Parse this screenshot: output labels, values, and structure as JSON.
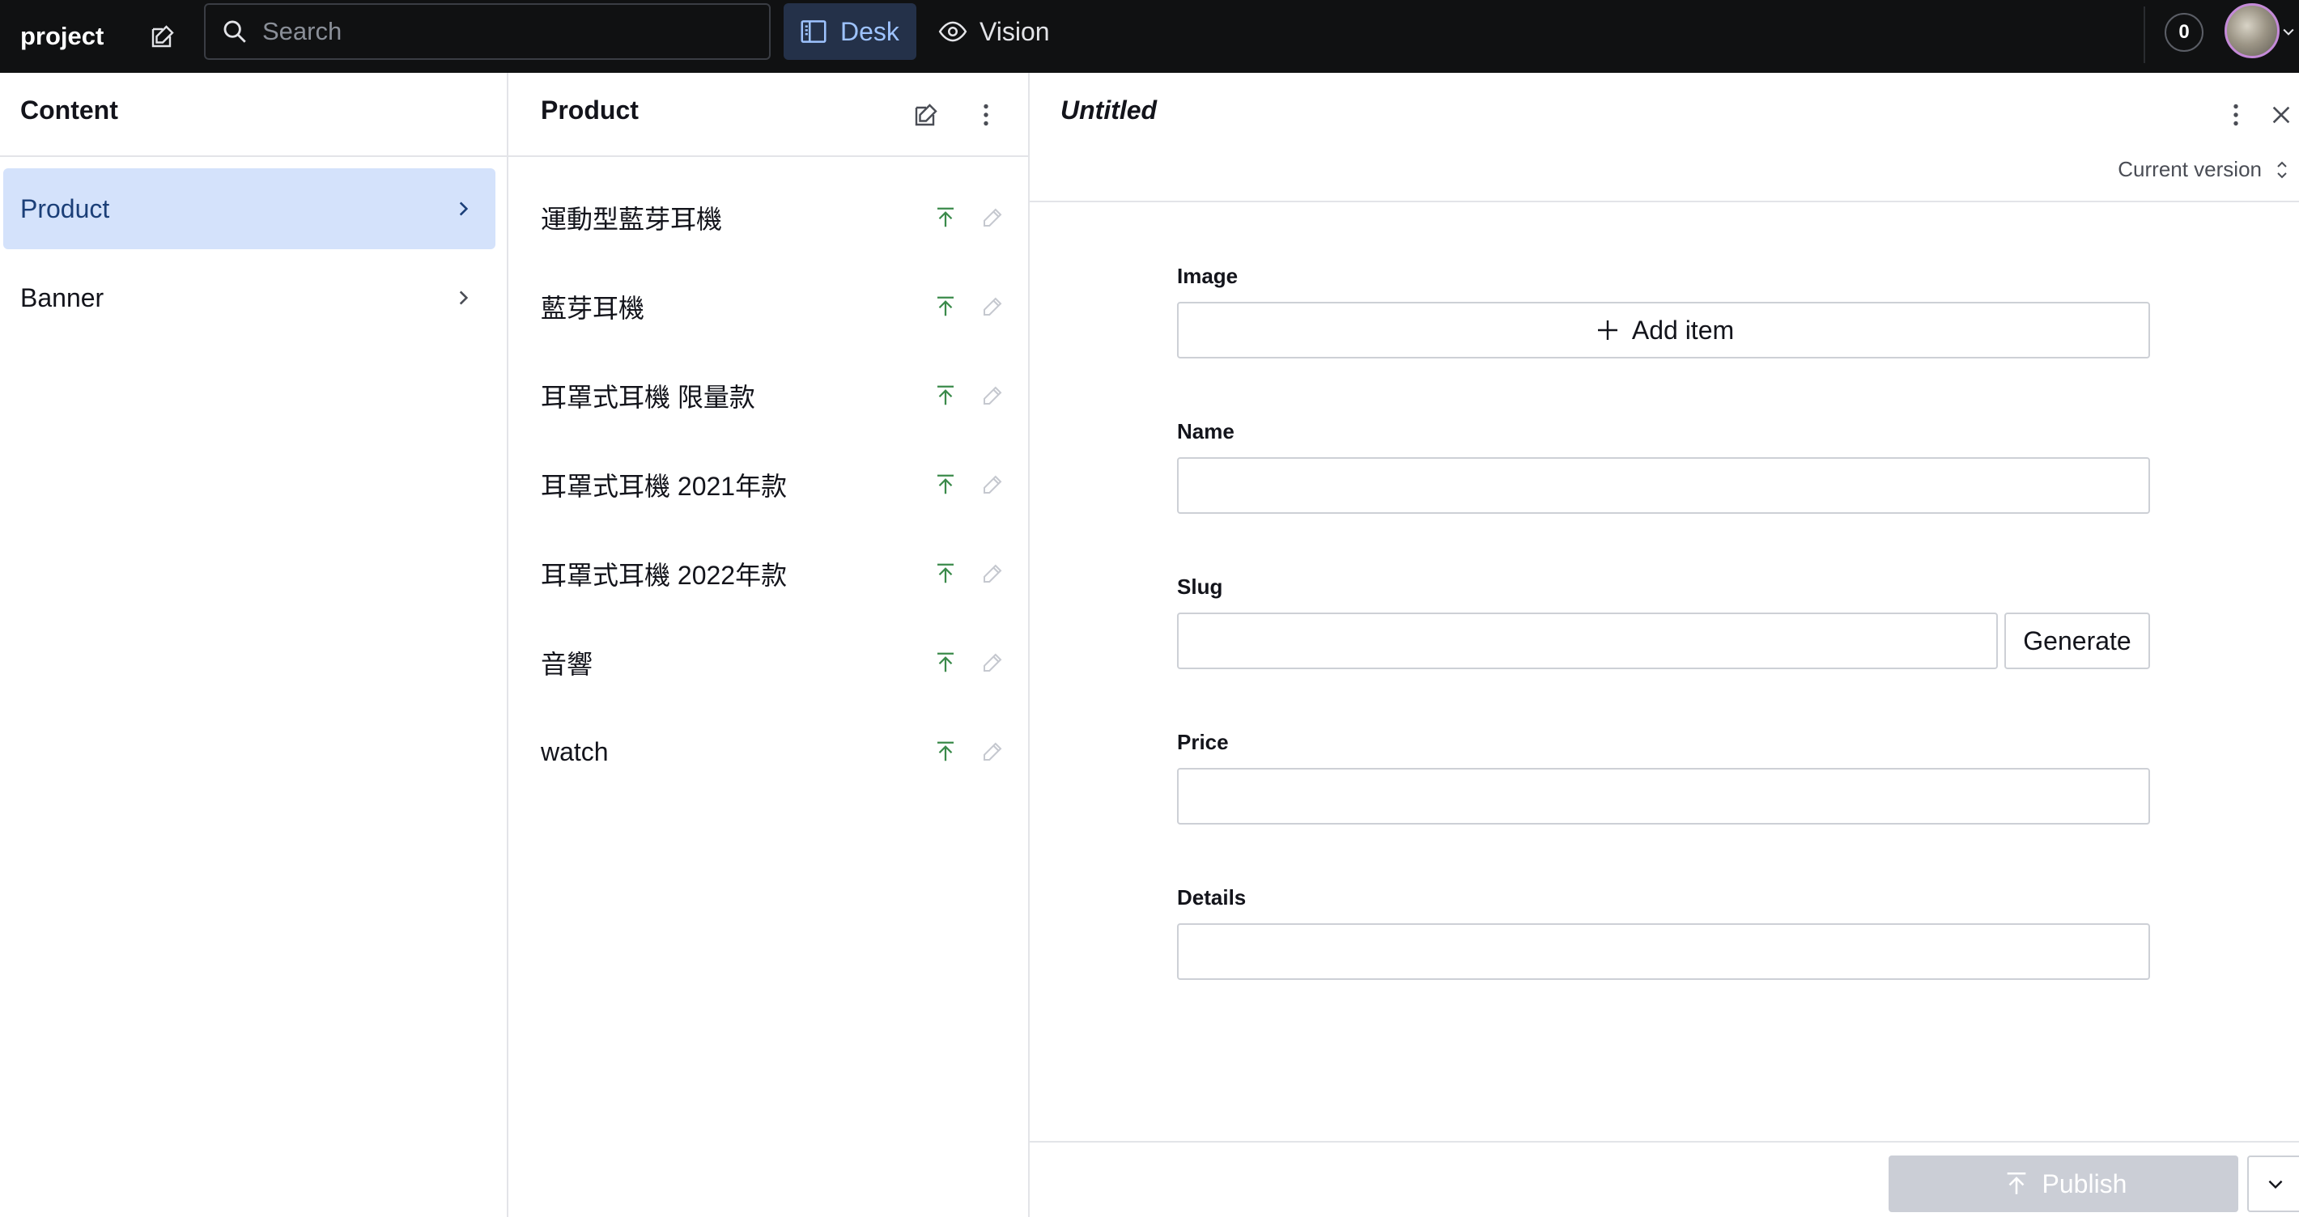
{
  "navbar": {
    "brand": "project",
    "search_placeholder": "Search",
    "tools": [
      {
        "label": "Desk",
        "icon": "desk-icon",
        "active": true
      },
      {
        "label": "Vision",
        "icon": "eye-icon",
        "active": false
      }
    ],
    "notification_count": "0"
  },
  "content_pane": {
    "title": "Content",
    "items": [
      {
        "label": "Product",
        "selected": true
      },
      {
        "label": "Banner",
        "selected": false
      }
    ]
  },
  "list_pane": {
    "title": "Product",
    "documents": [
      {
        "title": "運動型藍芽耳機"
      },
      {
        "title": "藍芽耳機"
      },
      {
        "title": "耳罩式耳機 限量款"
      },
      {
        "title": "耳罩式耳機 2021年款"
      },
      {
        "title": "耳罩式耳機 2022年款"
      },
      {
        "title": "音響"
      },
      {
        "title": "watch"
      }
    ]
  },
  "editor": {
    "title": "Untitled",
    "version_label": "Current version",
    "fields": {
      "image_label": "Image",
      "add_item_label": "Add item",
      "name_label": "Name",
      "name_value": "",
      "slug_label": "Slug",
      "slug_value": "",
      "generate_label": "Generate",
      "price_label": "Price",
      "price_value": "",
      "details_label": "Details",
      "details_value": ""
    },
    "publish_label": "Publish"
  },
  "colors": {
    "navbar_bg": "#101112",
    "active_tool_bg": "#243149",
    "selected_item_bg": "#d4e2fb",
    "published_icon": "#3a8a4a",
    "publish_button_disabled": "#cbced6"
  }
}
